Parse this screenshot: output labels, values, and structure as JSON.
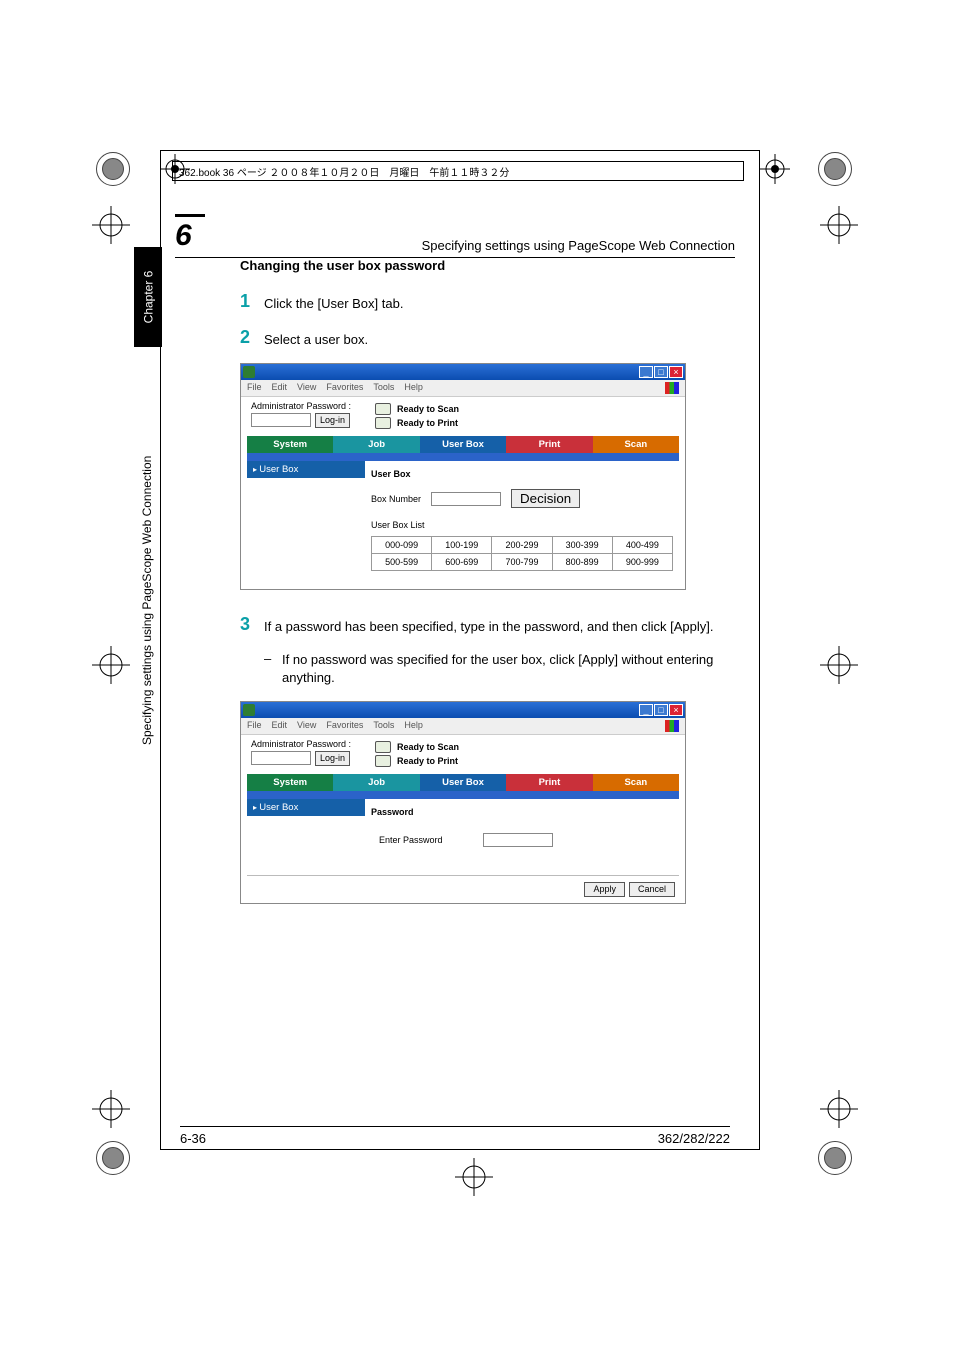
{
  "book_header": "362.book  36 ページ  ２００８年１０月２０日　月曜日　午前１１時３２分",
  "chapter_number_large": "6",
  "running_title": "Specifying settings using PageScope Web Connection",
  "side_tab": "Chapter 6",
  "side_text": "Specifying settings using PageScope Web Connection",
  "section_heading": "Changing the user box password",
  "steps": {
    "s1_num": "1",
    "s1_text": "Click the [User Box] tab.",
    "s2_num": "2",
    "s2_text": "Select a user box.",
    "s3_num": "3",
    "s3_text": "If a password has been specified, type in the password, and then click [Apply].",
    "s3_sub": "If no password was specified for the user box, click [Apply] without entering anything."
  },
  "browser": {
    "menu": {
      "file": "File",
      "edit": "Edit",
      "view": "View",
      "favorites": "Favorites",
      "tools": "Tools",
      "help": "Help"
    },
    "status1": "Ready to Scan",
    "status2": "Ready to Print",
    "admin_label": "Administrator Password :",
    "login_btn": "Log-in",
    "tabs": {
      "system": "System",
      "job": "Job",
      "userbox": "User Box",
      "print": "Print",
      "scan": "Scan"
    },
    "side_item": "User Box",
    "userbox_heading": "User Box",
    "box_number_label": "Box Number",
    "decision_btn": "Decision",
    "userbox_list_label": "User Box List",
    "ranges_row1": [
      "000-099",
      "100-199",
      "200-299",
      "300-399",
      "400-499"
    ],
    "ranges_row2": [
      "500-599",
      "600-699",
      "700-799",
      "800-899",
      "900-999"
    ],
    "password_heading": "Password",
    "enter_password_label": "Enter Password",
    "apply_btn": "Apply",
    "cancel_btn": "Cancel"
  },
  "footer": {
    "left": "6-36",
    "right": "362/282/222"
  }
}
